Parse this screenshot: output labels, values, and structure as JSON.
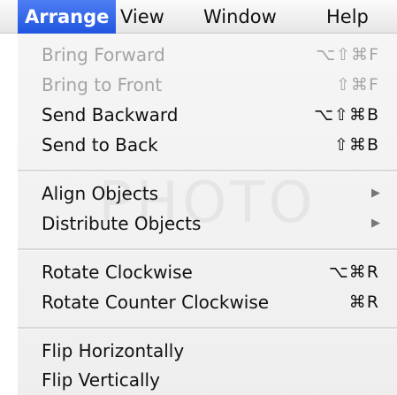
{
  "menubar": {
    "items": [
      {
        "label": "Arrange",
        "active": true
      },
      {
        "label": "View"
      },
      {
        "label": "Window"
      },
      {
        "label": "Help"
      }
    ]
  },
  "menu": {
    "watermark": "PHOTO",
    "groups": [
      {
        "items": [
          {
            "label": "Bring Forward",
            "shortcut": "⌥⇧⌘F",
            "enabled": false
          },
          {
            "label": "Bring to Front",
            "shortcut": "⇧⌘F",
            "enabled": false
          },
          {
            "label": "Send Backward",
            "shortcut": "⌥⇧⌘B",
            "enabled": true
          },
          {
            "label": "Send to Back",
            "shortcut": "⇧⌘B",
            "enabled": true
          }
        ]
      },
      {
        "items": [
          {
            "label": "Align Objects",
            "submenu": true,
            "enabled": true,
            "arrow": "▶"
          },
          {
            "label": "Distribute Objects",
            "submenu": true,
            "enabled": true,
            "arrow": "▶"
          }
        ]
      },
      {
        "items": [
          {
            "label": "Rotate Clockwise",
            "shortcut": "⌥⌘R",
            "enabled": true
          },
          {
            "label": "Rotate Counter Clockwise",
            "shortcut": "⌘R",
            "enabled": true
          }
        ]
      },
      {
        "items": [
          {
            "label": "Flip Horizontally",
            "enabled": true
          },
          {
            "label": "Flip Vertically",
            "enabled": true
          }
        ]
      }
    ]
  }
}
